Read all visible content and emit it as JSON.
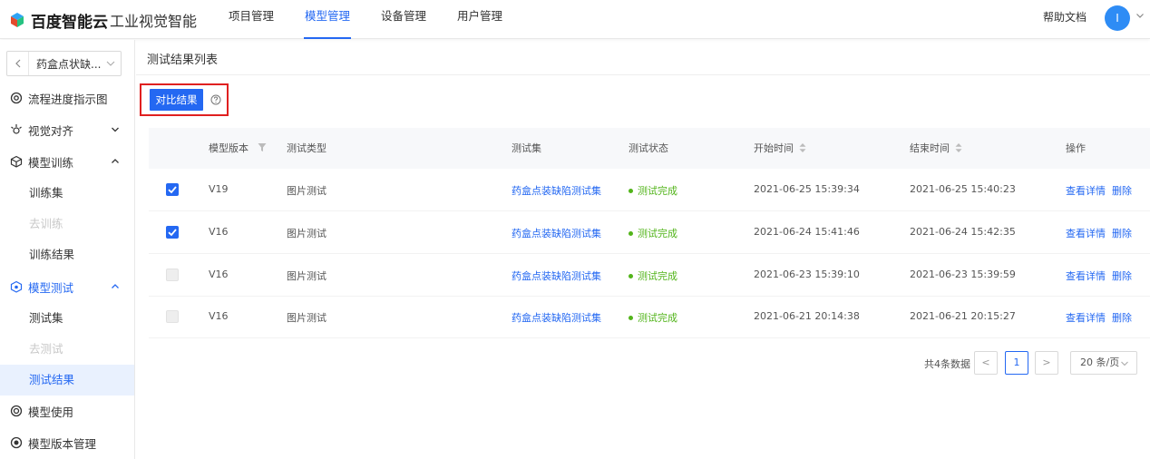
{
  "header": {
    "brand": "百度智能云",
    "product": "工业视觉智能",
    "nav": [
      "项目管理",
      "模型管理",
      "设备管理",
      "用户管理"
    ],
    "active_nav": 1,
    "help": "帮助文档",
    "avatar_letter": "I"
  },
  "sidebar": {
    "project": "药盒点状缺...",
    "items": [
      {
        "label": "流程进度指示图"
      },
      {
        "label": "视觉对齐"
      },
      {
        "label": "模型训练"
      },
      {
        "label": "训练集"
      },
      {
        "label": "去训练"
      },
      {
        "label": "训练结果"
      },
      {
        "label": "模型测试"
      },
      {
        "label": "测试集"
      },
      {
        "label": "去测试"
      },
      {
        "label": "测试结果"
      },
      {
        "label": "模型使用"
      },
      {
        "label": "模型版本管理"
      }
    ]
  },
  "main": {
    "title": "测试结果列表",
    "compare_button": "对比结果",
    "columns": [
      "模型版本",
      "测试类型",
      "测试集",
      "测试状态",
      "开始时间",
      "结束时间",
      "操作"
    ],
    "rows": [
      {
        "checked": true,
        "version": "V19",
        "type": "图片测试",
        "dataset": "药盒点装缺陷测试集",
        "status": "测试完成",
        "start": "2021-06-25 15:39:34",
        "end": "2021-06-25 15:40:23",
        "action_view": "查看详情",
        "action_delete": "删除"
      },
      {
        "checked": true,
        "version": "V16",
        "type": "图片测试",
        "dataset": "药盒点装缺陷测试集",
        "status": "测试完成",
        "start": "2021-06-24 15:41:46",
        "end": "2021-06-24 15:42:35",
        "action_view": "查看详情",
        "action_delete": "删除"
      },
      {
        "checked": false,
        "version": "V16",
        "type": "图片测试",
        "dataset": "药盒点装缺陷测试集",
        "status": "测试完成",
        "start": "2021-06-23 15:39:10",
        "end": "2021-06-23 15:39:59",
        "action_view": "查看详情",
        "action_delete": "删除"
      },
      {
        "checked": false,
        "version": "V16",
        "type": "图片测试",
        "dataset": "药盒点装缺陷测试集",
        "status": "测试完成",
        "start": "2021-06-21 20:14:38",
        "end": "2021-06-21 20:15:27",
        "action_view": "查看详情",
        "action_delete": "删除"
      }
    ],
    "pagination": {
      "total": "共4条数据",
      "current": "1",
      "prev": "<",
      "next": ">",
      "page_size": "20 条/页"
    }
  },
  "colors": {
    "accent": "#2468f2",
    "success": "#52b41a",
    "highlight": "#e02020"
  }
}
